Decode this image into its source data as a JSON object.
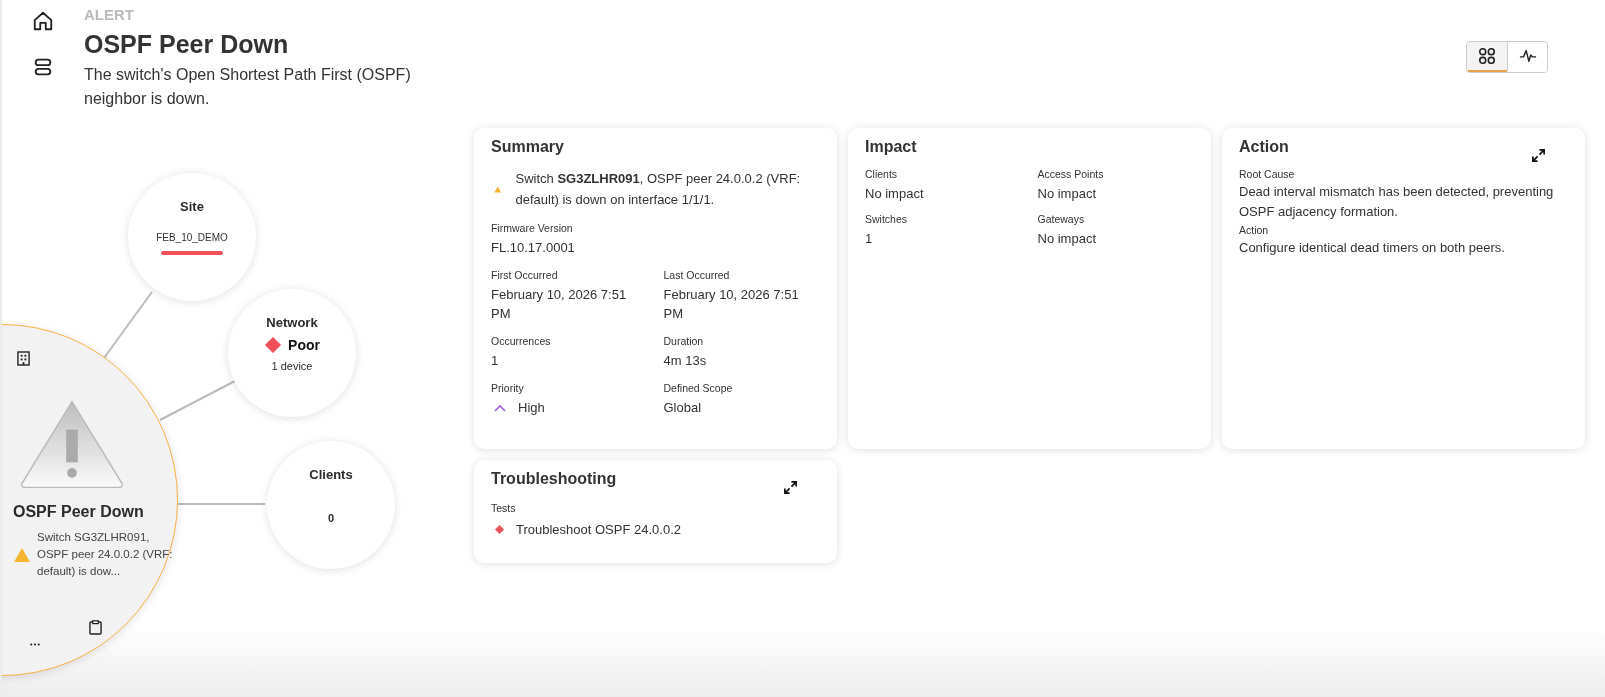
{
  "header": {
    "eyebrow": "ALERT",
    "title": "OSPF Peer Down",
    "description": "The switch's Open Shortest Path First (OSPF) neighbor is down."
  },
  "view_toggle": [
    {
      "kind": "grid",
      "selected": true
    },
    {
      "kind": "pulse",
      "selected": false
    }
  ],
  "graph": {
    "alert": {
      "title": "OSPF Peer Down",
      "message": "Switch SG3ZLHR091, OSPF peer 24.0.0.2 (VRF: default) is dow..."
    },
    "nodes": [
      {
        "kind": "site",
        "title": "Site",
        "value": "FEB_10_DEMO"
      },
      {
        "kind": "network",
        "title": "Network",
        "value": "Poor",
        "detail": "1 device"
      },
      {
        "kind": "clients",
        "title": "Clients",
        "value": "0"
      }
    ]
  },
  "summary": {
    "title": "Summary",
    "message": "Switch **SG3ZLHR091**, OSPF peer 24.0.0.2 (VRF: default) is down on interface 1/1/1.",
    "firmware": {
      "label": "Firmware Version",
      "value": "FL.10.17.0001"
    },
    "fields": [
      {
        "kind": "text",
        "label": "First Occurred",
        "value": "February 10, 2026 7:51 PM"
      },
      {
        "kind": "text",
        "label": "Last Occurred",
        "value": "February 10, 2026 7:51 PM"
      },
      {
        "kind": "text",
        "label": "Occurrences",
        "value": "1"
      },
      {
        "kind": "text",
        "label": "Duration",
        "value": "4m 13s"
      },
      {
        "kind": "priority",
        "label": "Priority",
        "value": "High"
      },
      {
        "kind": "text",
        "label": "Defined Scope",
        "value": "Global"
      }
    ]
  },
  "impact": {
    "title": "Impact",
    "fields": [
      {
        "label": "Clients",
        "value": "No impact"
      },
      {
        "label": "Access Points",
        "value": "No impact"
      },
      {
        "label": "Switches",
        "value": "1"
      },
      {
        "label": "Gateways",
        "value": "No impact"
      }
    ]
  },
  "action": {
    "title": "Action",
    "sections": [
      {
        "label": "Root Cause",
        "text": "Dead interval mismatch has been detected, preventing OSPF adjacency formation."
      },
      {
        "label": "Action",
        "text": "Configure identical dead timers on both peers."
      }
    ]
  },
  "troubleshooting": {
    "title": "Troubleshooting",
    "tests_label": "Tests",
    "tests": [
      {
        "name": "Troubleshoot OSPF 24.0.0.2"
      }
    ]
  }
}
